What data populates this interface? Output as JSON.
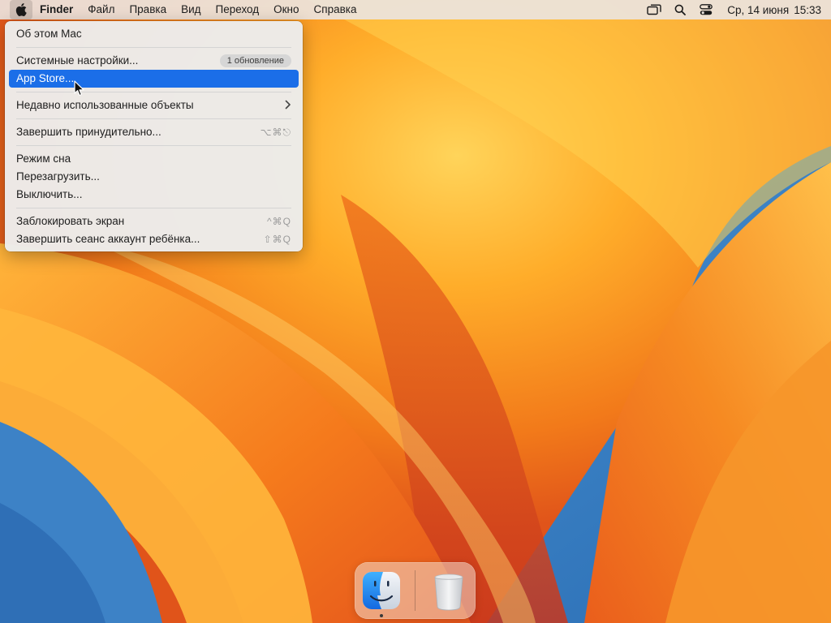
{
  "menubar": {
    "apple_icon": "apple-logo-icon",
    "app_name": "Finder",
    "menus": [
      "Файл",
      "Правка",
      "Вид",
      "Переход",
      "Окно",
      "Справка"
    ],
    "status_icons": [
      "screen-mirroring-icon",
      "spotlight-search-icon",
      "control-center-icon"
    ],
    "date": "Ср, 14 июня",
    "time": "15:33"
  },
  "apple_menu": {
    "about": "Об этом Mac",
    "system_settings": "Системные настройки...",
    "update_badge": "1 обновление",
    "app_store": "App Store...",
    "recent_items": "Недавно использованные объекты",
    "force_quit": "Завершить принудительно...",
    "force_quit_shortcut": "⌥⌘⎋",
    "sleep": "Режим сна",
    "restart": "Перезагрузить...",
    "shutdown": "Выключить...",
    "lock_screen": "Заблокировать экран",
    "lock_screen_shortcut": "^⌘Q",
    "logout": "Завершить сеанс аккаунт ребёнка...",
    "logout_shortcut": "⇧⌘Q",
    "highlighted_item": "App Store..."
  },
  "dock": {
    "apps": [
      {
        "name": "Finder",
        "icon": "finder-icon",
        "running": true
      },
      {
        "name": "Trash",
        "icon": "trash-icon",
        "running": false
      }
    ]
  },
  "colors": {
    "highlight": "#1b6ee8",
    "wallpaper_orange": "#f07a1c",
    "wallpaper_blue": "#3b82c4"
  }
}
